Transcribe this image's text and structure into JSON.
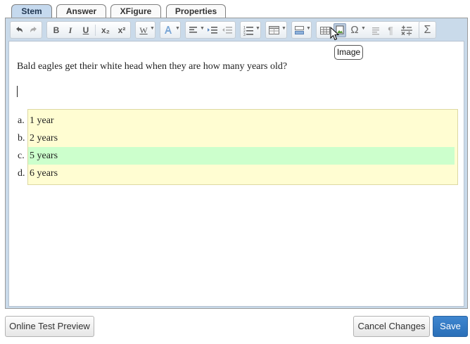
{
  "tabs": [
    {
      "label": "Stem",
      "active": true
    },
    {
      "label": "Answer",
      "active": false
    },
    {
      "label": "XFigure",
      "active": false
    },
    {
      "label": "Properties",
      "active": false
    }
  ],
  "toolbar": {
    "undo_icon": "undo-icon",
    "redo_icon": "redo-icon",
    "bold": "B",
    "italic": "I",
    "underline": "U",
    "subscript": "x₂",
    "superscript": "x²",
    "word_style": "W",
    "omega": "Ω",
    "pilcrow": "¶",
    "sigma": "Σ"
  },
  "tooltip": {
    "text": "Image"
  },
  "question": {
    "stem": "Bald eagles get their white head when they are how many years old?",
    "choices": [
      {
        "letter": "a.",
        "text": "1 year",
        "correct": false
      },
      {
        "letter": "b.",
        "text": "2 years",
        "correct": false
      },
      {
        "letter": "c.",
        "text": "5 years",
        "correct": true
      },
      {
        "letter": "d.",
        "text": "6 years",
        "correct": false
      }
    ]
  },
  "buttons": {
    "preview": "Online Test Preview",
    "cancel": "Cancel Changes",
    "save": "Save"
  },
  "colors": {
    "accent": "#2a6fb8",
    "answer_bg": "#fffdd2",
    "correct_bg": "#ccffcc",
    "frame_bg": "#c9daea"
  }
}
